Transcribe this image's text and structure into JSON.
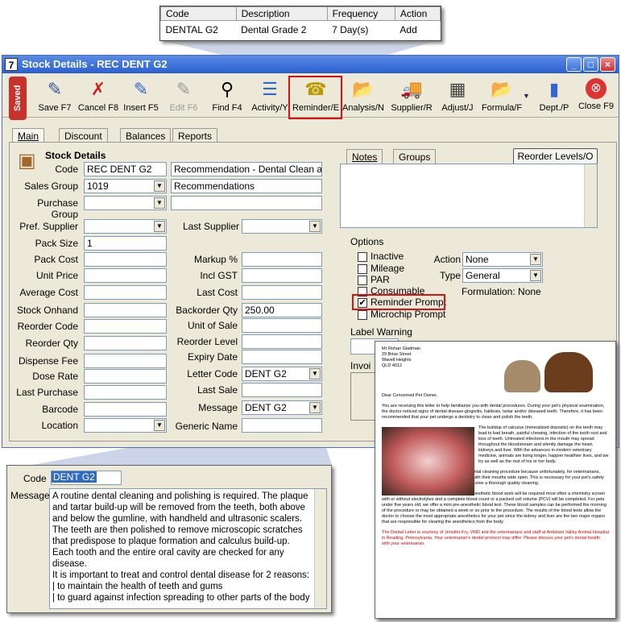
{
  "popup_table": {
    "headers": [
      "Code",
      "Description",
      "Frequency",
      "Action"
    ],
    "row": [
      "DENTAL G2",
      "Dental Grade 2",
      "7 Day(s)",
      "Add"
    ]
  },
  "window": {
    "title": "Stock Details - REC DENT G2",
    "icon": "7"
  },
  "toolbar": {
    "saved": "Saved",
    "buttons": [
      "Save F7",
      "Cancel F8",
      "Insert F5",
      "Edit F6",
      "Find F4",
      "Activity/Y",
      "Reminder/E",
      "Analysis/N",
      "Supplier/R",
      "Adjust/J",
      "Formula/F",
      "Dept./P",
      "Close F9"
    ]
  },
  "tabs": [
    "Main",
    "Discount",
    "Balances",
    "Reports"
  ],
  "section_title": "Stock Details",
  "fields": {
    "code_label": "Code",
    "code": "REC DENT G2",
    "code_desc": "Recommendation - Dental Clean and F",
    "sales_group_label": "Sales Group",
    "sales_group": "1019",
    "sales_group_desc": "Recommendations",
    "purchase_group_label": "Purchase Group",
    "pref_supplier_label": "Pref. Supplier",
    "last_supplier_label": "Last Supplier",
    "pack_size_label": "Pack Size",
    "pack_size": "1",
    "pack_cost_label": "Pack Cost",
    "markup_label": "Markup %",
    "unit_price_label": "Unit Price",
    "incl_gst_label": "Incl GST",
    "average_cost_label": "Average Cost",
    "last_cost_label": "Last Cost",
    "stock_onhand_label": "Stock Onhand",
    "backorder_qty_label": "Backorder Qty",
    "backorder_qty": "250.00",
    "reorder_code_label": "Reorder Code",
    "unit_of_sale_label": "Unit of Sale",
    "reorder_qty_label": "Reorder Qty",
    "reorder_level_label": "Reorder Level",
    "dispense_fee_label": "Dispense Fee",
    "expiry_date_label": "Expiry Date",
    "dose_rate_label": "Dose Rate",
    "letter_code_label": "Letter Code",
    "letter_code": "DENT G2",
    "last_purchase_label": "Last Purchase",
    "last_sale_label": "Last Sale",
    "barcode_label": "Barcode",
    "message_label": "Message",
    "message": "DENT G2",
    "location_label": "Location",
    "generic_name_label": "Generic Name"
  },
  "right_panel": {
    "tabs": [
      "Notes",
      "Groups"
    ],
    "reorder_button": "Reorder Levels/O",
    "options_title": "Options",
    "checkboxes": [
      {
        "label": "Inactive",
        "checked": false
      },
      {
        "label": "Mileage",
        "checked": false
      },
      {
        "label": "PAR",
        "checked": false
      },
      {
        "label": "Consumable",
        "checked": false
      },
      {
        "label": "Reminder Prompt",
        "checked": true
      },
      {
        "label": "Microchip Prompt",
        "checked": false
      }
    ],
    "action_label": "Action",
    "action_value": "None",
    "type_label": "Type",
    "type_value": "General",
    "formulation": "Formulation: None",
    "label_warning": "Label Warning",
    "invoice_label": "Invoi"
  },
  "message_popup": {
    "code_label": "Code",
    "code": "DENT G2",
    "message_label": "Message",
    "text": [
      "A routine dental cleaning and polishing is required. The plaque and tartar build-up will be removed from the teeth, both above and below the gumline, with handheld and ultrasonic scalers. The teeth are then polished to remove microscopic scratches that predispose to plaque formation and calculus build-up. Each tooth and the entire oral cavity are checked for any disease.",
      "It is important to treat and control dental disease for 2 reasons:",
      "| to maintain the health of teeth and gums",
      "| to guard against infection spreading to other parts of the body"
    ]
  },
  "letter": {
    "address": [
      "Mr Rohan Gladman",
      "29 Brise Street",
      "Wavell Heights",
      "QLD 4012"
    ],
    "greeting": "Dear Concerned Pet Owner,",
    "p1": "You are receiving this letter to help familiarize you with dental procedures. During your pet's physical examination, the doctor noticed signs of dental disease-gingivitis, halitosis, tartar and/or diseased teeth. Therefore, it has been recommended that your pet undergo a dentistry to clean and polish the teeth.",
    "p2": "The buildup of calculus (mineralized deposits) on the teeth may lead to bad breath, painful chewing, infection of the tooth root and loss of teeth. Untreated infections in the mouth may spread throughout the bloodstream and silently damage the heart, kidneys and liver. With the advances in modern veterinary medicine, animals are living longer, happier healthier lives, and we try as well as the rest of his or her body.",
    "p3": "Your pet will be anesthetized to undergo the dental cleaning procedure because unfortunately, for veterinarians, dogs and cats do not remain seated in a chair with their mouths wide open. This is necessary for your pet's safety and comfort. Under anesthesia, your pet will receive a thorough quality cleaning.",
    "p4": "If your pet is OVER FIVE YEARS of age, pre-anesthetic blood work will be required most often a chemistry screen with or without electrolytes and a complete blood count or a packed cell volume (PCV) will be completed. For pets under five years old, we offer a mini pre-anesthetic blood test. These blood samples can be performed the morning of the procedure or may be obtained a week or so prior to the procedure. The results of the blood tests allow the doctor to choose the most appropriate anesthetics for your pet since the kidney and liver are the two major organs that are responsible for clearing the anesthetics from the body.",
    "p5": "The Dental Letter is courtesy of Jennifer Fry, VMD and the veterinarians and staff at Antietam Valley Animal Hospital in Reading, Pennsylvania. Your veterinarian's dental protocol may differ. Please discuss your pet's dental health with your veterinarian."
  },
  "colors": {
    "highlight_red": "#d11111",
    "title_blue": "#2a5fcf",
    "saved_red": "#c8322a"
  }
}
